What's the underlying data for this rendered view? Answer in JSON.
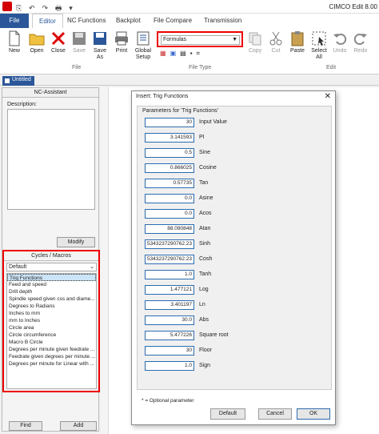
{
  "title_bar": {
    "title": "CIMCO Edit 8.00",
    "qat_icons": "⎘ ↶ ↷ 🖶 ▾"
  },
  "ribbon_tabs": [
    "File",
    "Editor",
    "NC Functions",
    "Backplot",
    "File Compare",
    "Transmission"
  ],
  "ribbon": {
    "new": "New",
    "open": "Open",
    "close": "Close",
    "save": "Save",
    "save_as": "Save As",
    "print": "Print",
    "global_setup": "Global Setup",
    "file_group": "File",
    "file_type_select": "Formulas",
    "file_type_group": "File Type",
    "copy": "Copy",
    "cut": "Cut",
    "paste": "Paste",
    "select_all": "Select All",
    "undo": "Undo",
    "redo": "Redo",
    "edit_group": "Edit"
  },
  "doc_tab": "Untitled",
  "nc_assistant": {
    "header": "NC-Assistant",
    "description_label": "Description:",
    "modify": "Modify"
  },
  "cycles": {
    "header": "Cycles / Macros",
    "select": "Default",
    "items": [
      "Trig Functions",
      "Feed and speed",
      "Drill depth",
      "Spindle speed given css and diame...",
      "Degrees to Radians",
      "Inches to mm",
      "mm to Inches",
      "Circle area",
      "Circle circumference",
      "Macro B Circle",
      "Degrees per minute given feedrate ...",
      "Feedrate given degrees per minute ...",
      "Degrees per minute for Linear with ..."
    ],
    "find": "Find",
    "add": "Add"
  },
  "dialog": {
    "title": "Insert: Trig Functions",
    "frame_label": "Parameters for 'Trig Functions'",
    "params": [
      {
        "value": "30",
        "label": "Input Value"
      },
      {
        "value": "3.141593",
        "label": "PI"
      },
      {
        "value": "0.5",
        "label": "Sine"
      },
      {
        "value": "0.866025",
        "label": "Cosine"
      },
      {
        "value": "0.57735",
        "label": "Tan"
      },
      {
        "value": "0.0",
        "label": "Asine"
      },
      {
        "value": "0.0",
        "label": "Acos"
      },
      {
        "value": "88.090848",
        "label": "Atan"
      },
      {
        "value": "5343237290762.23",
        "label": "Sinh"
      },
      {
        "value": "5343237290762.23",
        "label": "Cosh"
      },
      {
        "value": "1.0",
        "label": "Tanh"
      },
      {
        "value": "1.477121",
        "label": "Log"
      },
      {
        "value": "3.401197",
        "label": "Ln"
      },
      {
        "value": "30.0",
        "label": "Abs"
      },
      {
        "value": "5.477226",
        "label": "Square root"
      },
      {
        "value": "30",
        "label": "Floor"
      },
      {
        "value": "1.0",
        "label": "Sign"
      }
    ],
    "optional_note": "* = Optional parameter",
    "default_btn": "Default",
    "cancel_btn": "Cancel",
    "ok_btn": "OK"
  },
  "colors": {
    "accent": "#2b579a",
    "highlight": "#e00000"
  }
}
